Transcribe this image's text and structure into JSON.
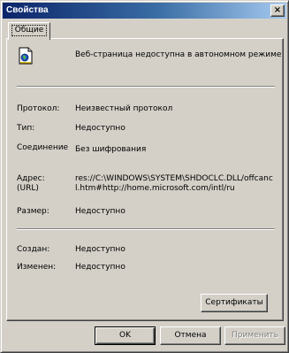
{
  "window": {
    "title": "Свойства",
    "close_glyph": "×"
  },
  "tabs": [
    {
      "label": "Общие",
      "active": true
    }
  ],
  "heading": "Веб-страница недоступна в автономном режиме",
  "icon": "web-page-icon",
  "properties": {
    "protocol": {
      "label": "Протокол:",
      "value": "Неизвестный протокол"
    },
    "type": {
      "label": "Тип:",
      "value": "Недоступно"
    },
    "connection": {
      "label": "Соединение",
      "value": "Без шифрования"
    },
    "address": {
      "label_line1": "Адрес:",
      "label_line2": "(URL)",
      "value": "res://C:\\WINDOWS\\SYSTEM\\SHDOCLC.DLL/offcancl.htm#http://home.microsoft.com/intl/ru"
    },
    "size": {
      "label": "Размер:",
      "value": "Недоступно"
    },
    "created": {
      "label": "Создан:",
      "value": "Недоступно"
    },
    "modified": {
      "label": "Изменен:",
      "value": "Недоступно"
    }
  },
  "buttons": {
    "certificates": "Сертификаты",
    "ok": "OK",
    "cancel": "Отмена",
    "apply": "Применить"
  },
  "colors": {
    "face": "#d4d0c8",
    "title_start": "#0a246a",
    "title_end": "#a6caf0"
  }
}
